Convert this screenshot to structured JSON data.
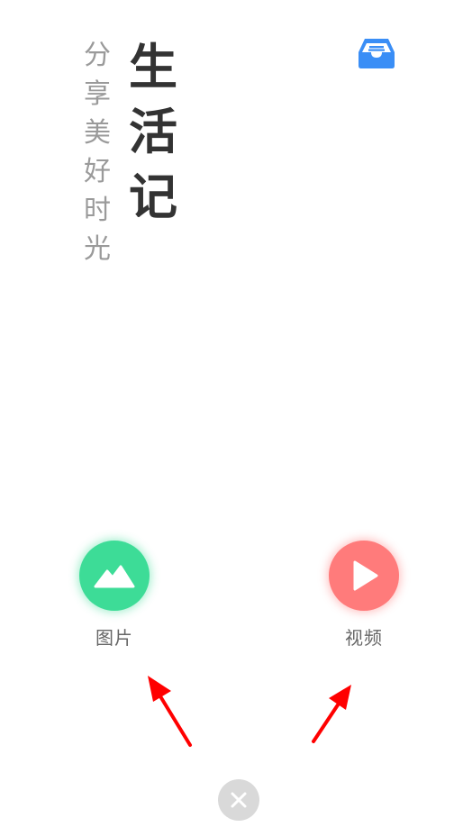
{
  "header": {
    "subtitle_chars": [
      "分",
      "享",
      "美",
      "好",
      "时",
      "光"
    ],
    "title_chars": [
      "生",
      "活",
      "记"
    ],
    "inbox_icon": "inbox-icon"
  },
  "actions": {
    "photo": {
      "label": "图片",
      "icon": "mountain-icon",
      "color": "#3ddc97"
    },
    "video": {
      "label": "视频",
      "icon": "play-icon",
      "color": "#ff7b7b"
    }
  },
  "annotations": {
    "arrow_color": "#ff0000"
  },
  "close": {
    "icon": "close-icon"
  },
  "colors": {
    "accent_blue": "#3a8ef6",
    "title_text": "#333333",
    "subtitle_text": "#9a9a9a"
  }
}
